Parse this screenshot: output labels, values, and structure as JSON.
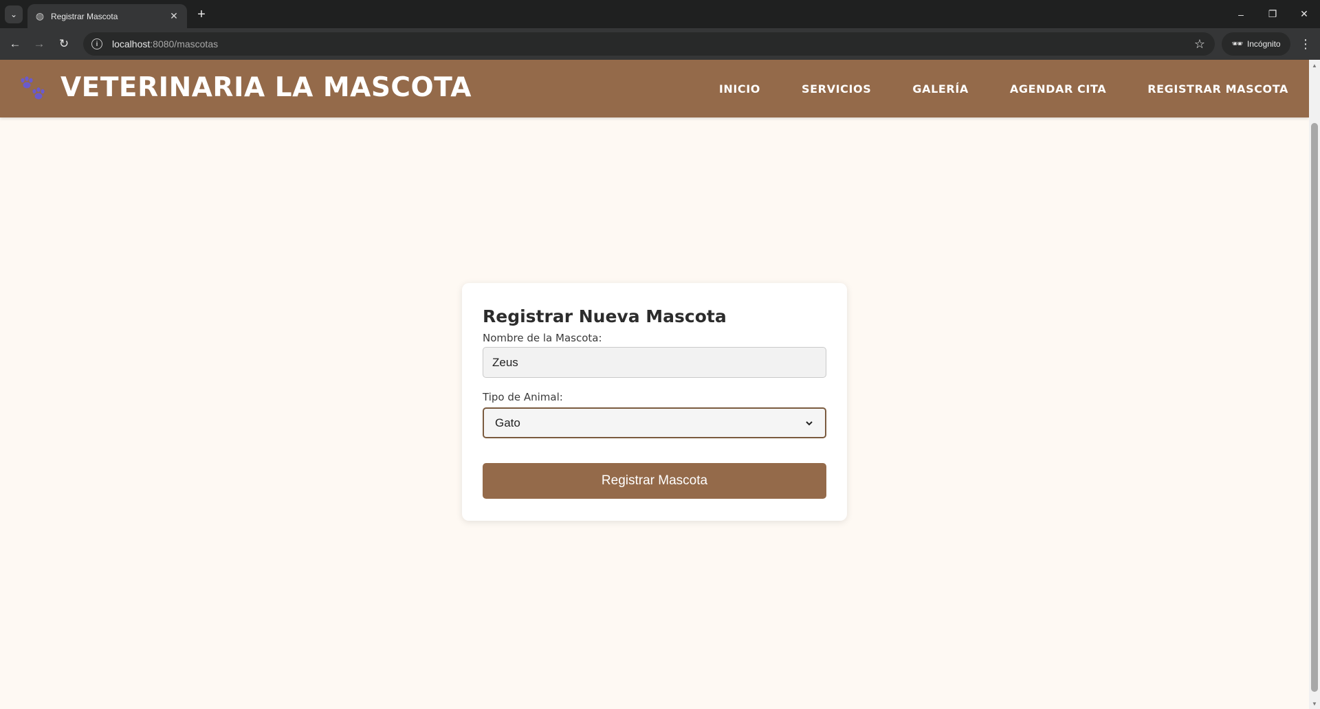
{
  "browser": {
    "tab_title": "Registrar Mascota",
    "url_host": "localhost",
    "url_path": ":8080/mascotas",
    "incognito_label": "Incógnito"
  },
  "site": {
    "title": "VETERINARIA LA MASCOTA",
    "nav": [
      {
        "label": "INICIO"
      },
      {
        "label": "SERVICIOS"
      },
      {
        "label": "GALERÍA"
      },
      {
        "label": "AGENDAR CITA"
      },
      {
        "label": "REGISTRAR MASCOTA"
      }
    ]
  },
  "form": {
    "title": "Registrar Nueva Mascota",
    "name_label": "Nombre de la Mascota:",
    "name_value": "Zeus",
    "type_label": "Tipo de Animal:",
    "type_value": "Gato",
    "submit_label": "Registrar Mascota"
  },
  "colors": {
    "header_bg": "#946a4a",
    "page_bg": "#fef9f3",
    "paw": "#6a5acd"
  },
  "icons": {
    "logo": "paw-prints-icon"
  }
}
